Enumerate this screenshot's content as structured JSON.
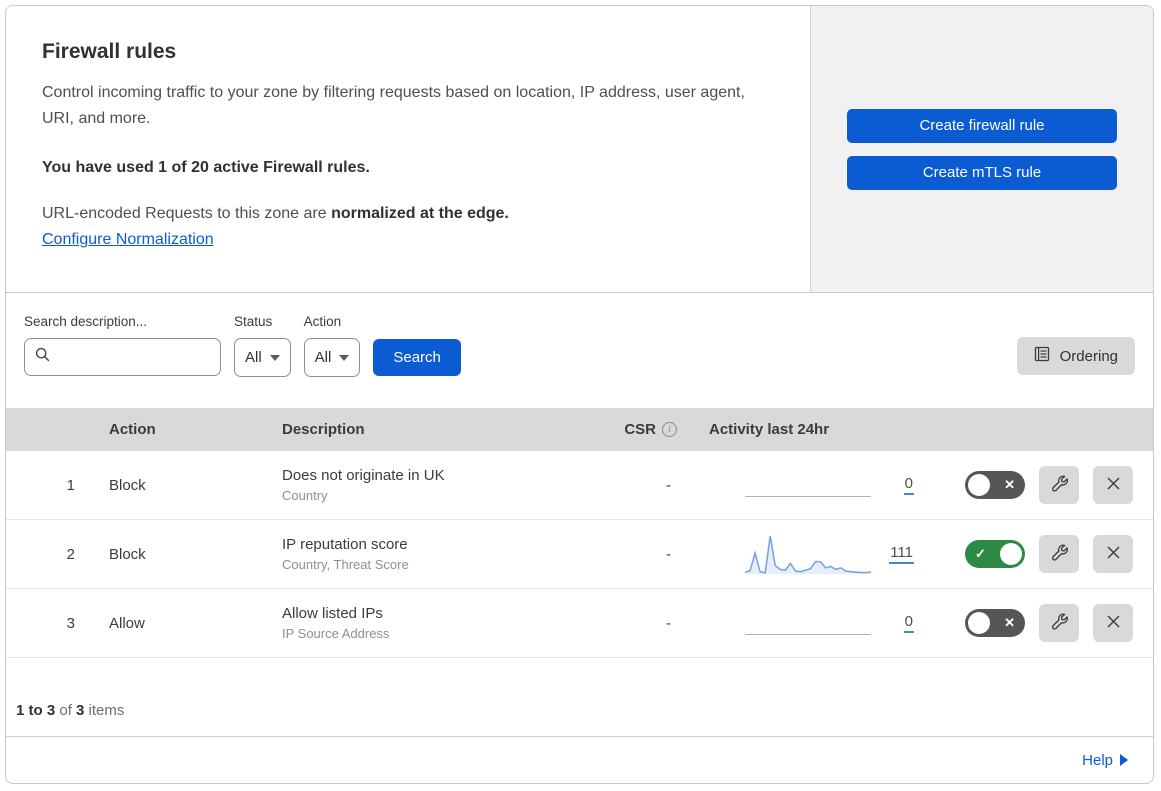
{
  "header": {
    "title": "Firewall rules",
    "description": "Control incoming traffic to your zone by filtering requests based on location, IP address, user agent, URI, and more.",
    "usage_notice": "You have used 1 of 20 active Firewall rules.",
    "normalization_prefix": "URL-encoded Requests to this zone are ",
    "normalization_bold": "normalized at the edge.",
    "normalization_link": "Configure Normalization",
    "create_firewall_rule_label": "Create firewall rule",
    "create_mtls_rule_label": "Create mTLS rule"
  },
  "filters": {
    "search_label": "Search description...",
    "status_label": "Status",
    "status_value": "All",
    "action_label": "Action",
    "action_value": "All",
    "search_button_label": "Search",
    "ordering_button_label": "Ordering"
  },
  "table": {
    "columns": {
      "action": "Action",
      "description": "Description",
      "csr": "CSR",
      "activity": "Activity last 24hr"
    },
    "rules": [
      {
        "number": "1",
        "action": "Block",
        "description": "Does not originate in UK",
        "criteria": "Country",
        "csr": "-",
        "activity_count": "0",
        "enabled": false,
        "sparkline": null
      },
      {
        "number": "2",
        "action": "Block",
        "description": "IP reputation score",
        "criteria": "Country, Threat Score",
        "csr": "-",
        "activity_count": "111",
        "enabled": true,
        "sparkline": [
          5,
          8,
          55,
          6,
          3,
          100,
          22,
          12,
          10,
          28,
          8,
          6,
          10,
          14,
          33,
          32,
          16,
          20,
          12,
          16,
          8,
          6,
          5,
          4,
          4,
          5
        ]
      },
      {
        "number": "3",
        "action": "Allow",
        "description": "Allow listed IPs",
        "criteria": "IP Source Address",
        "csr": "-",
        "activity_count": "0",
        "enabled": false,
        "sparkline": null
      }
    ]
  },
  "footer": {
    "range_bold": "1 to 3",
    "of_text": " of ",
    "total_bold": "3",
    "items_text": " items",
    "help_label": "Help"
  },
  "colors": {
    "accent_blue": "#0b5bd3",
    "toggle_on_green": "#2c8a43",
    "toggle_off_gray": "#565656",
    "sparkline_blue": "#74a0e4",
    "table_header_gray": "#d9d9d9",
    "side_panel_gray": "#f1f1f1"
  }
}
